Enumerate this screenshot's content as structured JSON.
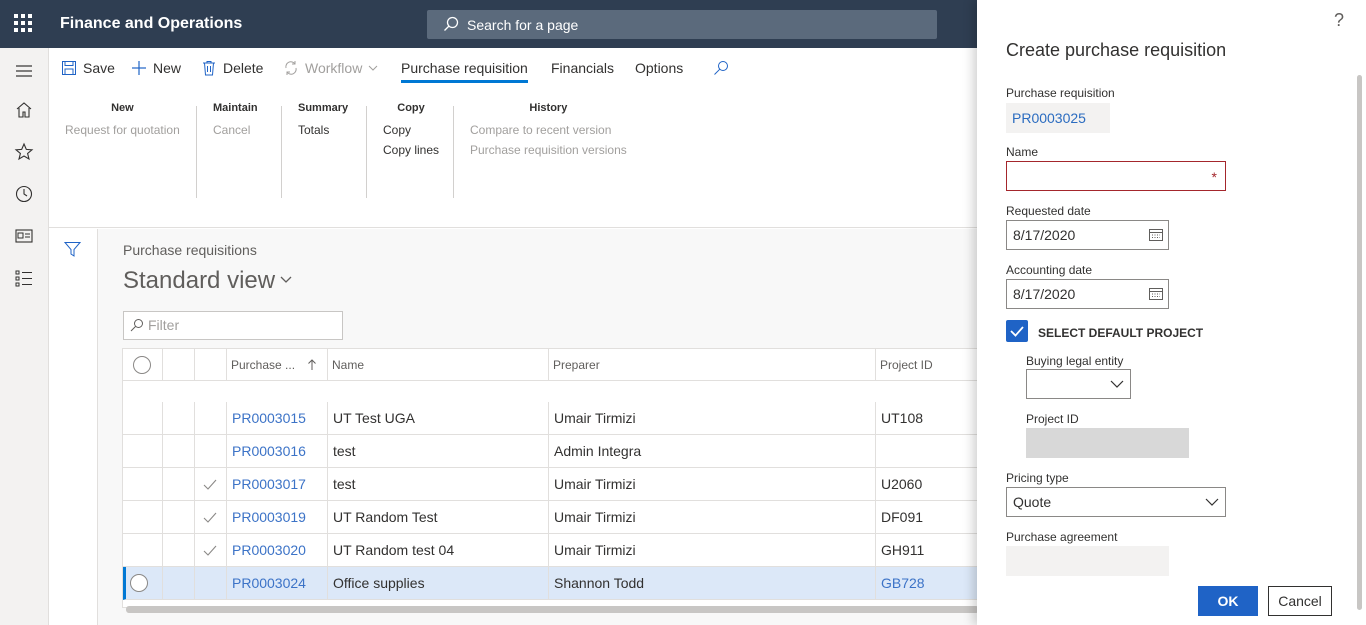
{
  "app": {
    "title": "Finance and Operations",
    "search_placeholder": "Search for a page"
  },
  "actions": {
    "save": "Save",
    "new": "New",
    "delete": "Delete",
    "workflow": "Workflow"
  },
  "tabs": [
    "Purchase requisition",
    "Financials",
    "Options"
  ],
  "ribbon": {
    "new": {
      "header": "New",
      "items": [
        "Request for quotation"
      ]
    },
    "maintain": {
      "header": "Maintain",
      "items": [
        "Cancel"
      ]
    },
    "summary": {
      "header": "Summary",
      "items": [
        "Totals"
      ]
    },
    "copy": {
      "header": "Copy",
      "items": [
        "Copy",
        "Copy lines"
      ]
    },
    "history": {
      "header": "History",
      "items": [
        "Compare to recent version",
        "Purchase requisition versions"
      ]
    }
  },
  "list": {
    "breadcrumb": "Purchase requisitions",
    "view_name": "Standard view",
    "filter_placeholder": "Filter",
    "columns": [
      "Purchase ...",
      "Name",
      "Preparer",
      "Project ID"
    ],
    "rows": [
      {
        "id": "PR0003015",
        "name": "UT Test UGA",
        "preparer": "Umair Tirmizi",
        "project": "UT108",
        "checked": false,
        "selected": false
      },
      {
        "id": "PR0003016",
        "name": "test",
        "preparer": "Admin Integra",
        "project": "",
        "checked": false,
        "selected": false
      },
      {
        "id": "PR0003017",
        "name": "test",
        "preparer": "Umair Tirmizi",
        "project": "U2060",
        "checked": true,
        "selected": false
      },
      {
        "id": "PR0003019",
        "name": "UT Random Test",
        "preparer": "Umair Tirmizi",
        "project": "DF091",
        "checked": true,
        "selected": false
      },
      {
        "id": "PR0003020",
        "name": "UT Random test 04",
        "preparer": "Umair Tirmizi",
        "project": "GH911",
        "checked": true,
        "selected": false
      },
      {
        "id": "PR0003024",
        "name": "Office supplies",
        "preparer": "Shannon Todd",
        "project": "GB728",
        "checked": false,
        "selected": true
      }
    ]
  },
  "panel": {
    "help": "?",
    "title": "Create purchase requisition",
    "pr_label": "Purchase requisition",
    "pr_value": "PR0003025",
    "name_label": "Name",
    "name_value": "",
    "required_mark": "*",
    "requested_date_label": "Requested date",
    "requested_date_value": "8/17/2020",
    "accounting_date_label": "Accounting date",
    "accounting_date_value": "8/17/2020",
    "select_default_project_label": "SELECT DEFAULT PROJECT",
    "select_default_project_checked": true,
    "buying_entity_label": "Buying legal entity",
    "buying_entity_value": "",
    "project_id_label": "Project ID",
    "pricing_type_label": "Pricing type",
    "pricing_type_value": "Quote",
    "purchase_agreement_label": "Purchase agreement",
    "ok": "OK",
    "cancel": "Cancel"
  },
  "colors": {
    "topbar": "#2f3e52",
    "accent": "#1f63c6",
    "link": "#3c73c7",
    "error": "#a4262c"
  }
}
